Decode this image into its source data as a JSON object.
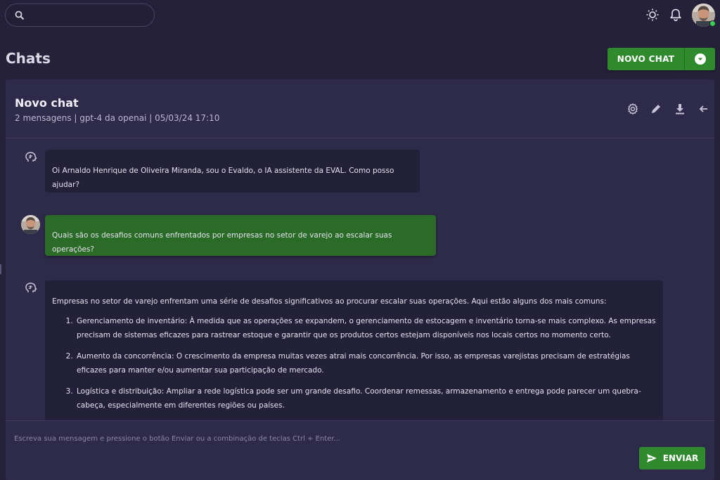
{
  "search": {
    "value": "",
    "placeholder": ""
  },
  "header": {
    "title": "Chats",
    "new_chat_label": "NOVO CHAT"
  },
  "chat": {
    "title": "Novo chat",
    "meta": "2 mensagens | gpt-4 da openai | 05/03/24 17:10"
  },
  "messages": [
    {
      "role": "assistant",
      "text": "Oi Arnaldo Henrique de Oliveira Miranda, sou o Evaldo, o IA assistente da EVAL. Como posso ajudar?"
    },
    {
      "role": "user",
      "text": "Quais são os desafios comuns enfrentados por empresas no setor de varejo ao escalar suas operações?"
    },
    {
      "role": "assistant",
      "intro": "Empresas no setor de varejo enfrentam uma série de desafios significativos ao procurar escalar suas operações. Aqui estão alguns dos mais comuns:",
      "items": [
        "Gerenciamento de inventário: À medida que as operações se expandem, o gerenciamento de estocagem e inventário torna-se mais complexo. As empresas precisam de sistemas eficazes para rastrear estoque e garantir que os produtos certos estejam disponíveis nos locais certos no momento certo.",
        "Aumento da concorrência: O crescimento da empresa muitas vezes atrai mais concorrência. Por isso, as empresas varejistas precisam de estratégias eficazes para manter e/ou aumentar sua participação de mercado.",
        "Logística e distribuição: Ampliar a rede logística pode ser um grande desafio. Coordenar remessas, armazenamento e entrega pode parecer um quebra-cabeça, especialmente em diferentes regiões ou países."
      ]
    }
  ],
  "composer": {
    "placeholder": "Escreva sua mensagem e pressione o botão Enviar ou a combinação de teclas Ctrl + Enter...",
    "send_label": "ENVIAR"
  },
  "colors": {
    "accent_green": "#2f8a2e",
    "panel": "#2e2a4a",
    "background": "#25213a"
  },
  "icons": [
    "search-icon",
    "theme-icon",
    "bell-icon",
    "settings-icon",
    "edit-icon",
    "download-icon",
    "back-arrow-icon",
    "brain-icon",
    "send-icon",
    "chevron-down-icon"
  ]
}
